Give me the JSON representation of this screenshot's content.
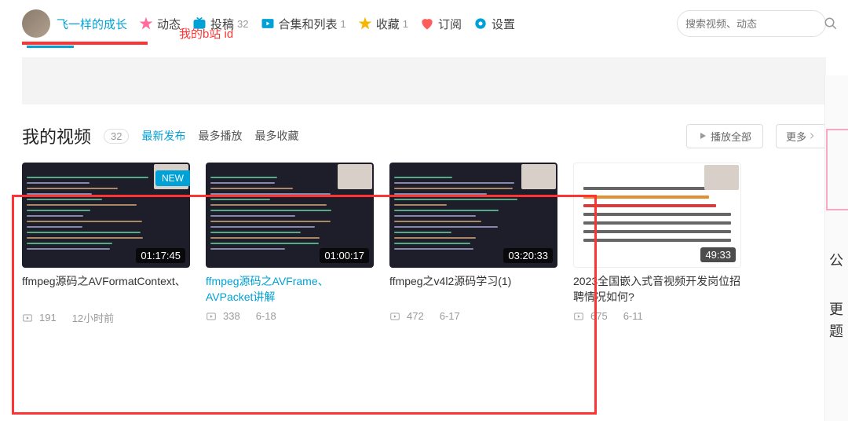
{
  "user": {
    "name": "飞一样的成长"
  },
  "nav": {
    "dynamic": "动态",
    "upload": "投稿",
    "upload_count": "32",
    "playlist": "合集和列表",
    "playlist_count": "1",
    "fav": "收藏",
    "fav_count": "1",
    "sub": "订阅",
    "settings": "设置"
  },
  "search": {
    "placeholder": "搜索视频、动态"
  },
  "annotation": "我的b站 id",
  "section": {
    "title": "我的视频",
    "count": "32",
    "sort_latest": "最新发布",
    "sort_plays": "最多播放",
    "sort_favs": "最多收藏",
    "play_all": "播放全部",
    "more": "更多"
  },
  "side": {
    "gong": "公",
    "geng": "更",
    "ti": "题"
  },
  "videos": [
    {
      "title": "ffmpeg源码之AVFormatContext、",
      "duration": "01:17:45",
      "views": "191",
      "date": "12小时前",
      "new": true,
      "link": false,
      "dark": true
    },
    {
      "title": "ffmpeg源码之AVFrame、AVPacket讲解",
      "duration": "01:00:17",
      "views": "338",
      "date": "6-18",
      "new": false,
      "link": true,
      "dark": true
    },
    {
      "title": "ffmpeg之v4l2源码学习(1)",
      "duration": "03:20:33",
      "views": "472",
      "date": "6-17",
      "new": false,
      "link": false,
      "dark": true
    },
    {
      "title": "2023全国嵌入式音视频开发岗位招聘情况如何?",
      "duration": "49:33",
      "views": "675",
      "date": "6-11",
      "new": false,
      "link": false,
      "dark": false
    }
  ],
  "new_badge": "NEW"
}
